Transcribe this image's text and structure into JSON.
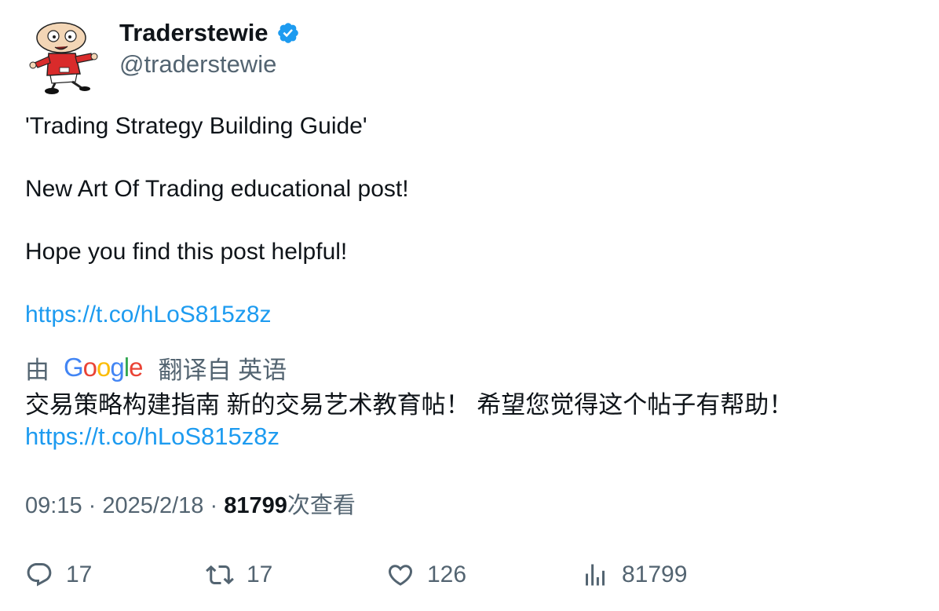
{
  "author": {
    "display_name": "Traderstewie",
    "handle": "@traderstewie",
    "verified_icon": "verified-badge-icon",
    "avatar_icon": "cartoon-avatar"
  },
  "tweet": {
    "line1": "'Trading Strategy Building Guide'",
    "line2": "New Art Of Trading educational post!",
    "line3": "Hope you find this post helpful!",
    "link": "https://t.co/hLoS815z8z"
  },
  "translation": {
    "prefix": "由",
    "google": [
      "G",
      "o",
      "o",
      "g",
      "l",
      "e"
    ],
    "suffix": "翻译自 英语",
    "text": "交易策略构建指南 新的交易艺术教育帖！ 希望您觉得这个帖子有帮助！",
    "link": "https://t.co/hLoS815z8z"
  },
  "meta": {
    "time": "09:15",
    "separator": "·",
    "date": "2025/2/18",
    "views_count": "81799",
    "views_label": "次查看"
  },
  "actions": {
    "replies": "17",
    "retweets": "17",
    "likes": "126",
    "views": "81799"
  },
  "colors": {
    "link": "#1d9bf0",
    "secondary_text": "#536471",
    "primary_text": "#0f1419",
    "verified": "#1d9bf0",
    "google_blue": "#4285F4",
    "google_red": "#EA4335",
    "google_yellow": "#FBBC05",
    "google_green": "#34A853"
  }
}
